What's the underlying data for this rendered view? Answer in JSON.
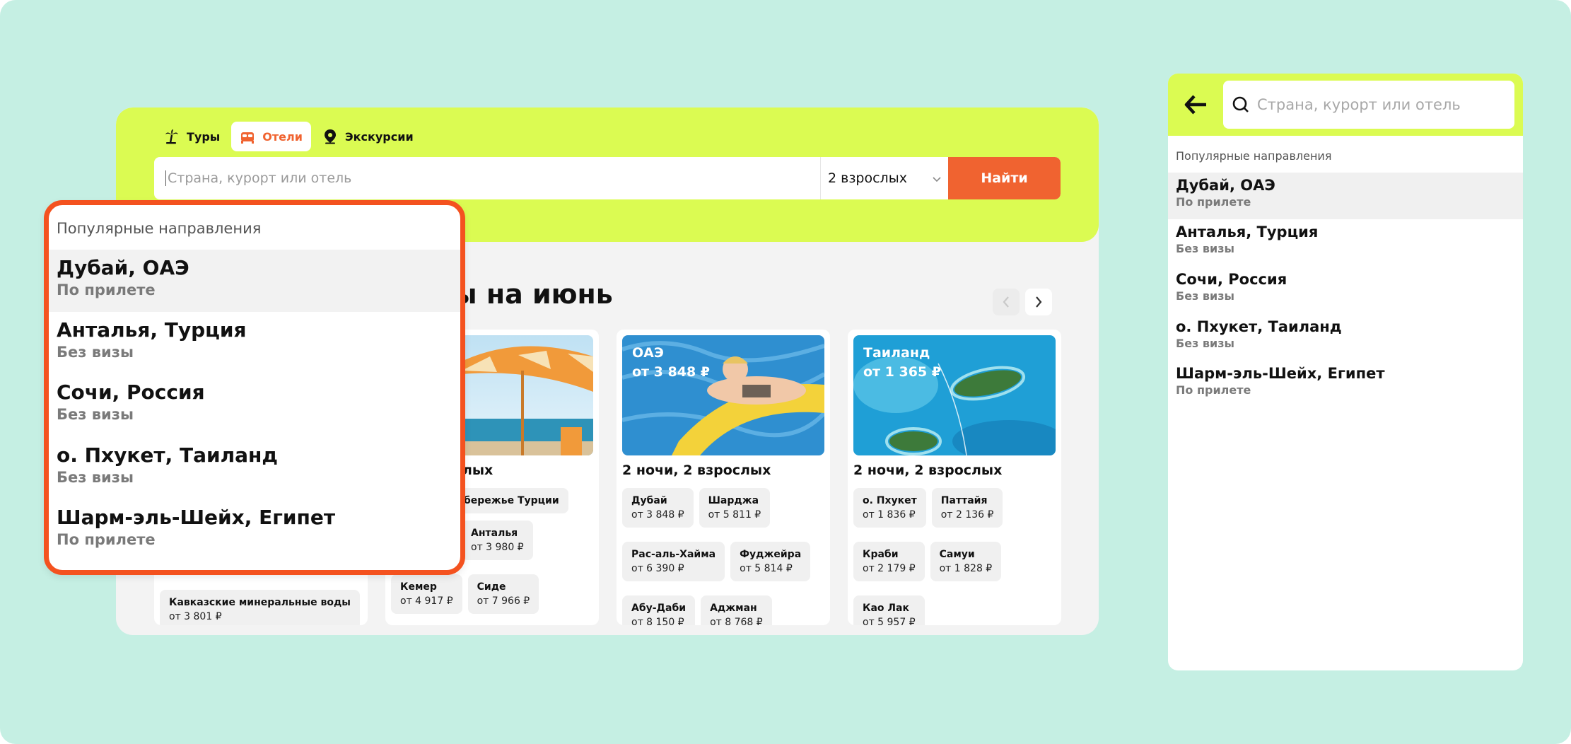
{
  "colors": {
    "background": "#c5efe3",
    "accent_lime": "#dbfb52",
    "accent_orange": "#f06330",
    "highlight_border": "#f4521f"
  },
  "tabs": [
    {
      "label": "Туры",
      "icon": "palm-tree-icon"
    },
    {
      "label": "Отели",
      "icon": "bed-icon"
    },
    {
      "label": "Экскурсии",
      "icon": "location-pin-icon"
    }
  ],
  "search": {
    "placeholder": "Страна, курорт или отель",
    "guests": "2 взрослых",
    "button": "Найти"
  },
  "section_title": "ны на июнь",
  "cards": [
    {
      "nights": "зрослых",
      "chips": [
        {
          "name": "бережье Турции",
          "price": ""
        },
        {
          "name": "Анталья",
          "price": "от 3 980 ₽"
        },
        {
          "name": "Кемер",
          "price": "от 4 917 ₽"
        },
        {
          "name": "Сиде",
          "price": "от 7 966 ₽"
        }
      ]
    },
    {
      "country": "ОАЭ",
      "price": "от 3 848 ₽",
      "nights": "2 ночи, 2 взрослых",
      "chips": [
        {
          "name": "Дубай",
          "price": "от 3 848 ₽"
        },
        {
          "name": "Шарджа",
          "price": "от 5 811 ₽"
        },
        {
          "name": "Рас-аль-Хайма",
          "price": "от 6 390 ₽"
        },
        {
          "name": "Фуджейра",
          "price": "от 5 814 ₽"
        },
        {
          "name": "Абу-Даби",
          "price": "от 8 150 ₽"
        },
        {
          "name": "Аджман",
          "price": "от 8 768 ₽"
        }
      ]
    },
    {
      "country": "Таиланд",
      "price": "от 1 365 ₽",
      "nights": "2 ночи, 2 взрослых",
      "chips": [
        {
          "name": "о. Пхукет",
          "price": "от 1 836 ₽"
        },
        {
          "name": "Паттайя",
          "price": "от 2 136 ₽"
        },
        {
          "name": "Краби",
          "price": "от 2 179 ₽"
        },
        {
          "name": "Самуи",
          "price": "от 1 828 ₽"
        },
        {
          "name": "Као Лак",
          "price": "от 5 957 ₽"
        }
      ]
    }
  ],
  "left_chip": {
    "name": "Кавказские минеральные воды",
    "price": "от 3 801 ₽"
  },
  "popular": {
    "header": "Популярные направления",
    "items": [
      {
        "title": "Дубай, ОАЭ",
        "sub": "По прилете"
      },
      {
        "title": "Анталья, Турция",
        "sub": "Без визы"
      },
      {
        "title": "Сочи, Россия",
        "sub": "Без визы"
      },
      {
        "title": "о. Пхукет, Таиланд",
        "sub": "Без визы"
      },
      {
        "title": "Шарм-эль-Шейх, Египет",
        "sub": "По прилете"
      }
    ]
  },
  "mobile": {
    "placeholder": "Страна, курорт или отель",
    "back_icon": "arrow-left-icon",
    "search_icon": "search-icon"
  }
}
